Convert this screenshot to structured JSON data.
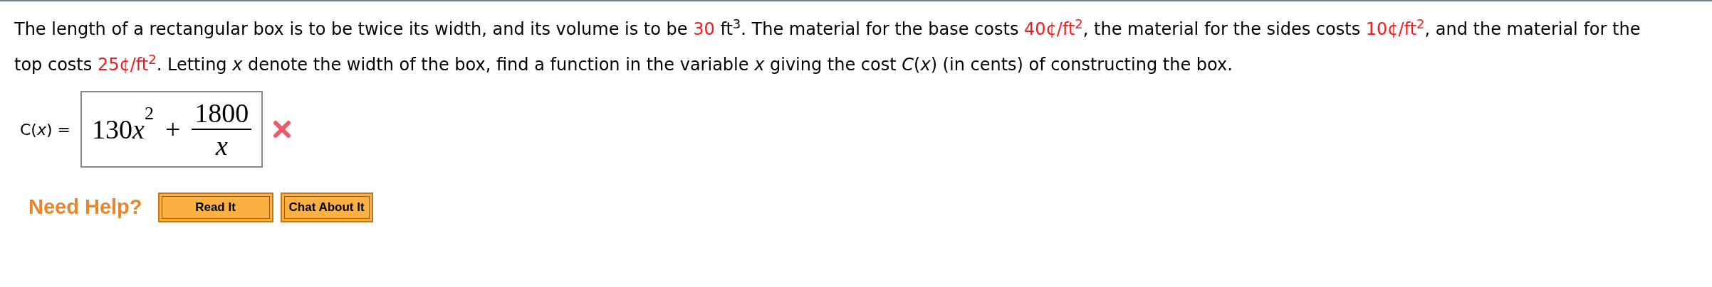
{
  "question": {
    "segments": [
      {
        "kind": "text",
        "text": "The length of a rectangular box is to be twice its width, and its volume is to be "
      },
      {
        "kind": "value",
        "text": "30"
      },
      {
        "kind": "text",
        "text": " ft$^{3}$. The material for the base costs "
      },
      {
        "kind": "value",
        "text": "40¢/ft$^{2}$"
      },
      {
        "kind": "text",
        "text": ", the material for the sides costs "
      },
      {
        "kind": "value",
        "text": "10¢/ft$^{2}$"
      },
      {
        "kind": "text",
        "text": ", and the material for the top costs "
      },
      {
        "kind": "value",
        "text": "25¢/ft$^{2}$"
      },
      {
        "kind": "text",
        "text": ". Letting *x* denote the width of the box, find a function in the variable *x* giving the cost *C*(*x*) (in cents) of constructing the box."
      }
    ]
  },
  "answer": {
    "label": "C(*x*) =",
    "coefficient": "130",
    "variable": "x",
    "exponent": "2",
    "operator": "+",
    "numerator": "1800",
    "denominator": "x",
    "correct": false
  },
  "help": {
    "title": "Need Help?",
    "buttons": [
      "Read It",
      "Chat About It"
    ]
  }
}
